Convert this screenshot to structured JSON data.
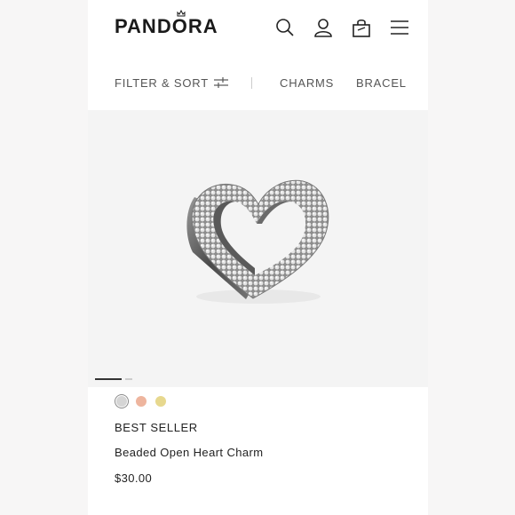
{
  "header": {
    "logo": "PANDORA",
    "icons": [
      "search-icon",
      "account-icon",
      "bag-icon",
      "menu-icon"
    ]
  },
  "nav": {
    "filter_label": "FILTER & SORT",
    "categories": [
      "CHARMS",
      "BRACEL"
    ]
  },
  "product": {
    "image_alt": "Beaded Open Heart Charm",
    "swatches": [
      {
        "name": "silver",
        "color": "#d5d5d5",
        "selected": true
      },
      {
        "name": "rose-gold",
        "color": "#eeb59e",
        "selected": false
      },
      {
        "name": "gold",
        "color": "#e7d88e",
        "selected": false
      }
    ],
    "badge": "BEST SELLER",
    "name": "Beaded Open Heart Charm",
    "price": "$30.00"
  },
  "colors": {
    "background": "#f7f6f6",
    "text": "#222222"
  }
}
